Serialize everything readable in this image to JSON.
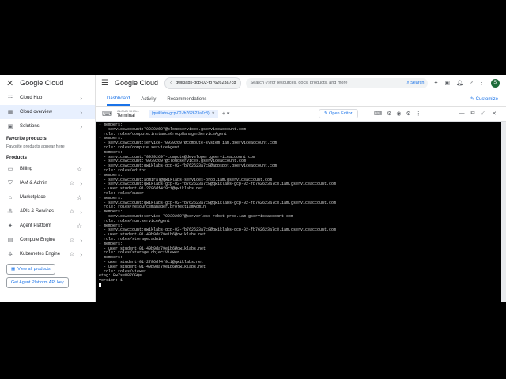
{
  "nav": {
    "brand": "Google Cloud",
    "items": [
      {
        "label": "Cloud Hub",
        "icon": "hub-icon"
      },
      {
        "label": "Cloud overview",
        "icon": "dashboard-icon"
      },
      {
        "label": "Solutions",
        "icon": "solutions-icon"
      }
    ],
    "favorites_heading": "Favorite products",
    "favorites_note": "Favorite products appear here",
    "products_heading": "Products",
    "products": [
      {
        "label": "Billing"
      },
      {
        "label": "IAM & Admin"
      },
      {
        "label": "Marketplace"
      },
      {
        "label": "APIs & Services"
      },
      {
        "label": "Agent Platform"
      },
      {
        "label": "Compute Engine"
      },
      {
        "label": "Kubernetes Engine"
      }
    ],
    "view_all": "View all products",
    "api_key": "Get Agent Platform API key"
  },
  "topbar": {
    "logo": "Google Cloud",
    "project": "qwiklabs-gcp-02-fb762623a7c8",
    "search_placeholder": "Search (/) for resources, docs, products, and more",
    "search_button": "Search",
    "avatar": "S"
  },
  "tabs": [
    "Dashboard",
    "Activity",
    "Recommendations"
  ],
  "customize": "Customize",
  "shell": {
    "label": "CLOUD SHELL",
    "title": "Terminal",
    "tab": "(qwiklabs-gcp-02-fb762623a7c8)",
    "open_editor": "Open Editor"
  },
  "terminal": {
    "lines": [
      "- members:",
      "  - serviceAccount:709392697@cloudservices.gserviceaccount.com",
      "  role: roles/compute.instanceGroupManagerServiceAgent",
      "- members:",
      "  - serviceAccount:service-709392697@compute-system.iam.gserviceaccount.com",
      "  role: roles/compute.serviceAgent",
      "- members:",
      "  - serviceAccount:709392697-compute@developer.gserviceaccount.com",
      "  - serviceAccount:709392697@cloudservices.gserviceaccount.com",
      "  - serviceAccount:qwiklabs-gcp-02-fb762623a7c8@appspot.gserviceaccount.com",
      "  role: roles/editor",
      "- members:",
      "  - serviceAccount:admiral@qwiklabs-services-prod.iam.gserviceaccount.com",
      "  - serviceAccount:qwiklabs-gcp-02-fb762623a7c8@qwiklabs-gcp-02-fb762623a7c8.iam.gserviceaccount.com",
      "  - user:student-01-2786df4f9c1@qwiklabs.net",
      "  role: roles/owner",
      "- members:",
      "  - serviceAccount:qwiklabs-gcp-02-fb762623a7c8@qwiklabs-gcp-02-fb762623a7c8.iam.gserviceaccount.com",
      "  role: roles/resourcemanager.projectIamAdmin",
      "- members:",
      "  - serviceAccount:service-709392697@serverless-robot-prod.iam.gserviceaccount.com",
      "  role: roles/run.serviceAgent",
      "- members:",
      "  - serviceAccount:qwiklabs-gcp-02-fb762623a7c8@qwiklabs-gcp-02-fb762623a7c8.iam.gserviceaccount.com",
      "  - user:student-01-49b9da79e1b6@qwiklabs.net",
      "  role: roles/storage.admin",
      "- members:",
      "  - user:student-01-49b9da79e1b6@qwiklabs.net",
      "  role: roles/storage.objectViewer",
      "- members:",
      "  - user:student-01-2786df4f9c1@qwiklabs.net",
      "  - user:student-01-49b9da79e1b6@qwiklabs.net",
      "  role: roles/viewer",
      "etag: BwZseW87CGQ=",
      "version: 1"
    ]
  }
}
